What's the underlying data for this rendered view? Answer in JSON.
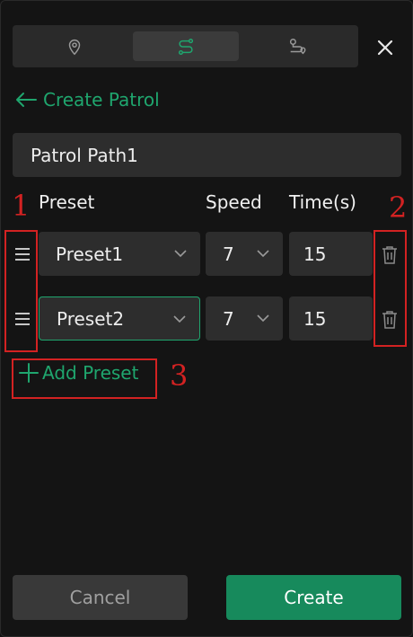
{
  "tabs": [
    {
      "icon": "location-pin-icon",
      "active": false
    },
    {
      "icon": "route-icon",
      "active": true
    },
    {
      "icon": "path-marker-icon",
      "active": false
    }
  ],
  "header": {
    "back_label": "Create Patrol"
  },
  "patrol_name": "Patrol Path1",
  "columns": {
    "preset": "Preset",
    "speed": "Speed",
    "time": "Time(s)"
  },
  "rows": [
    {
      "preset": "Preset1",
      "speed": "7",
      "time": "15"
    },
    {
      "preset": "Preset2",
      "speed": "7",
      "time": "15"
    }
  ],
  "add_preset_label": "Add Preset",
  "annotations": [
    "1",
    "2",
    "3"
  ],
  "footer": {
    "cancel_label": "Cancel",
    "create_label": "Create"
  },
  "colors": {
    "accent": "#1fa66e",
    "create_button": "#178a5c",
    "annotation": "#d32222"
  }
}
